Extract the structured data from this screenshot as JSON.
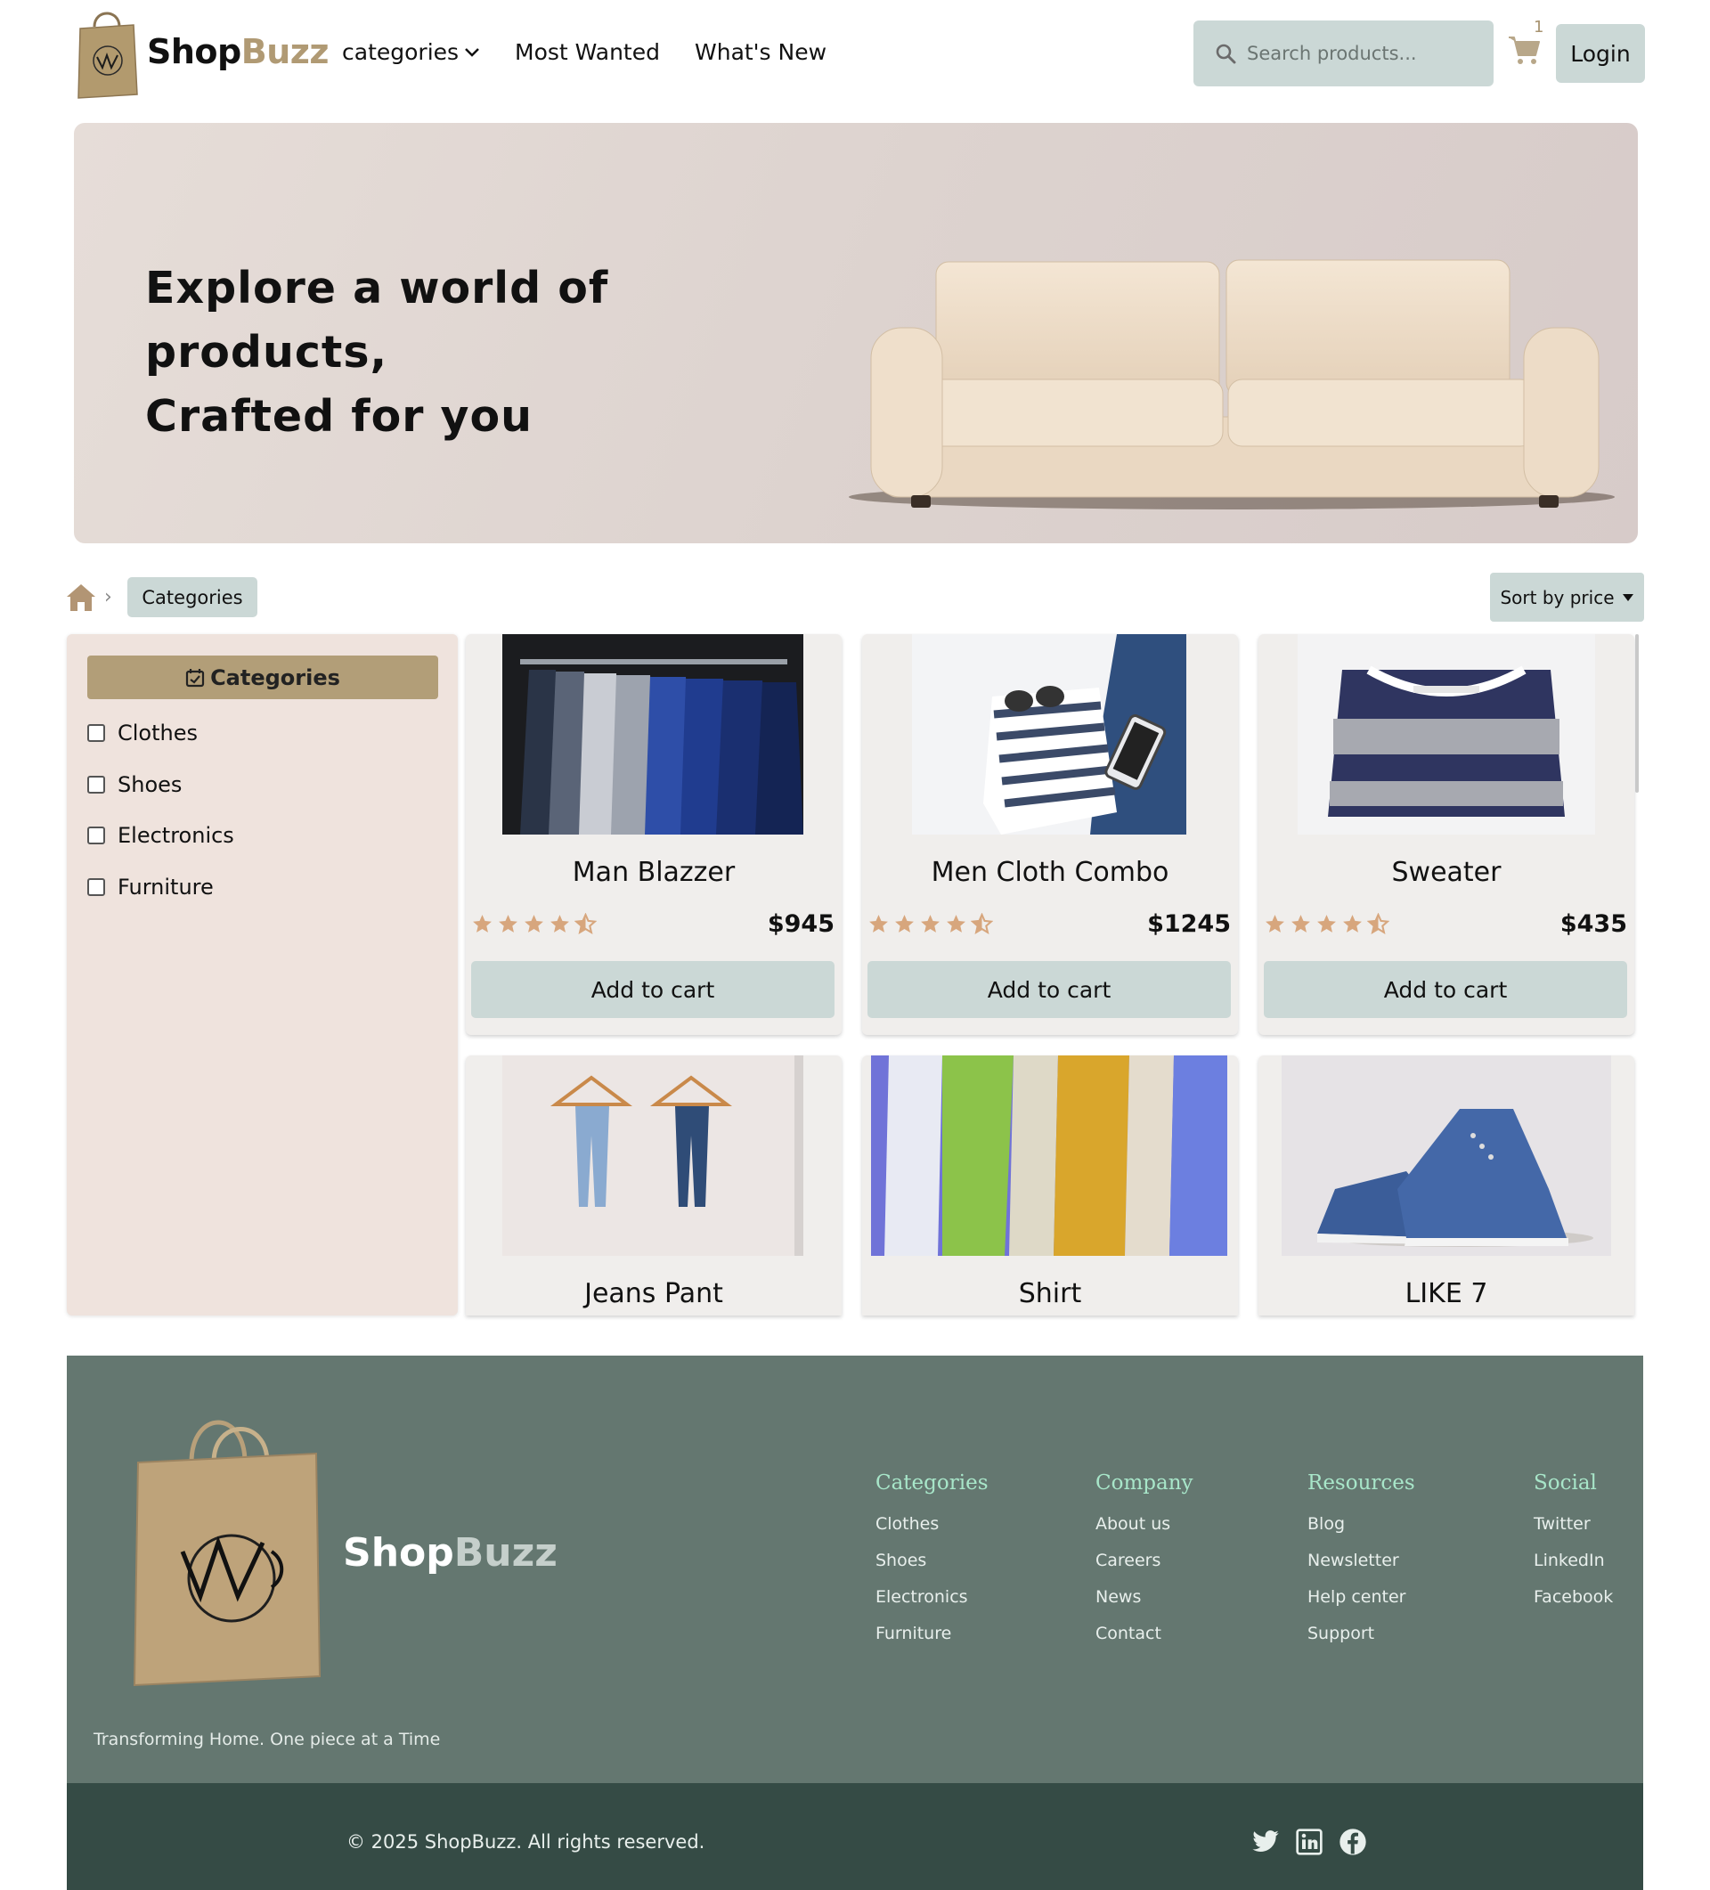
{
  "header": {
    "brand_part1": "Shop",
    "brand_part2": "Buzz",
    "nav": {
      "categories": "categories",
      "most_wanted": "Most Wanted",
      "whats_new": "What's New"
    },
    "search_placeholder": "Search products...",
    "cart_count": "1",
    "login_label": "Login"
  },
  "hero": {
    "line1": "Explore a world of products,",
    "line2": "Crafted for you"
  },
  "breadcrumb": {
    "current": "Categories"
  },
  "sort": {
    "label": "Sort by price"
  },
  "sidebar": {
    "heading": "Categories",
    "items": [
      {
        "label": "Clothes"
      },
      {
        "label": "Shoes"
      },
      {
        "label": "Electronics"
      },
      {
        "label": "Furniture"
      }
    ]
  },
  "products": [
    {
      "name": "Man Blazzer",
      "price": "$945",
      "rating": 4.5,
      "button": "Add to cart"
    },
    {
      "name": "Men Cloth Combo",
      "price": "$1245",
      "rating": 4.5,
      "button": "Add to cart"
    },
    {
      "name": "Sweater",
      "price": "$435",
      "rating": 4.5,
      "button": "Add to cart"
    },
    {
      "name": "Jeans Pant"
    },
    {
      "name": "Shirt"
    },
    {
      "name": "LIKE 7"
    }
  ],
  "footer": {
    "brand_part1": "Shop",
    "brand_part2": "Buzz",
    "tagline": "Transforming Home. One piece at a Time",
    "columns": [
      {
        "title": "Categories",
        "links": [
          "Clothes",
          "Shoes",
          "Electronics",
          "Furniture"
        ]
      },
      {
        "title": "Company",
        "links": [
          "About us",
          "Careers",
          "News",
          "Contact"
        ]
      },
      {
        "title": "Resources",
        "links": [
          "Blog",
          "Newsletter",
          "Help center",
          "Support"
        ]
      },
      {
        "title": "Social",
        "links": [
          "Twitter",
          "LinkedIn",
          "Facebook"
        ]
      }
    ],
    "copyright": "© 2025 ShopBuzz. All rights reserved.",
    "social_icons": [
      "twitter-icon",
      "linkedin-icon",
      "facebook-icon"
    ]
  },
  "colors": {
    "accent": "#b29e78",
    "button_bg": "#cbd8d6",
    "footer_bg": "#647770",
    "footer_bottom_bg": "#354b45",
    "star": "#d7a67d"
  }
}
